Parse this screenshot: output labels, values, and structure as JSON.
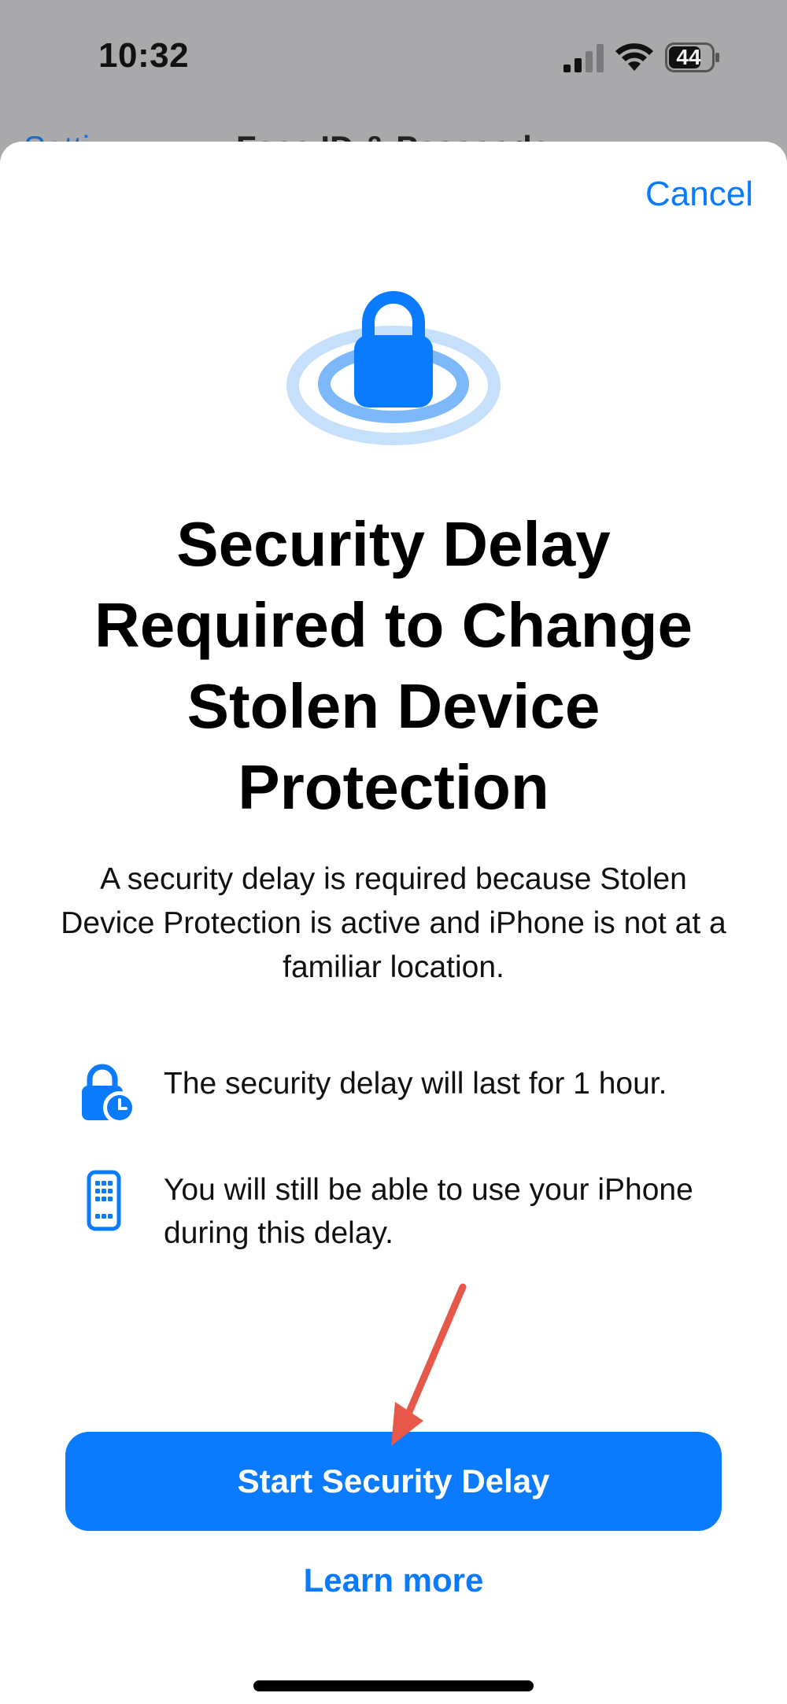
{
  "status_bar": {
    "time": "10:32",
    "battery_level": "44",
    "signal_icon": "cellular-signal-icon",
    "wifi_icon": "wifi-icon",
    "battery_icon": "battery-icon"
  },
  "nav_behind": {
    "back_label": "Setti",
    "title": "Face ID & Passcode"
  },
  "sheet": {
    "cancel_label": "Cancel",
    "hero_icon": "lock-rings-icon",
    "title": "Security Delay Required to Change Stolen Device Protection",
    "description": "A security delay is required because Stolen Device Protection is active and iPhone is not at a familiar location.",
    "info_items": [
      {
        "icon": "lock-clock-icon",
        "text": "The security delay will last for 1 hour."
      },
      {
        "icon": "iphone-icon",
        "text": "You will still be able to use your iPhone during this delay."
      }
    ],
    "primary_button_label": "Start Security Delay",
    "secondary_link_label": "Learn more"
  },
  "colors": {
    "accent": "#0a7bff",
    "arrow": "#e8584a",
    "backdrop": "#a9a9ab"
  }
}
